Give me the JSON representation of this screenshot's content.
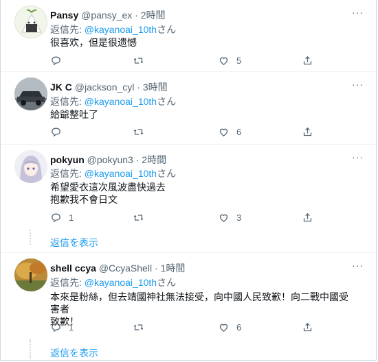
{
  "replies": [
    {
      "name": "Pansy",
      "handle": "@pansy_ex",
      "time": "2時間",
      "reply_prefix": "返信先:",
      "reply_to": "@kayanoai_10th",
      "reply_suffix": "さん",
      "lines": [
        "很喜欢，但是很遗憾"
      ],
      "reply_count": "",
      "retweet_count": "",
      "like_count": "5",
      "avatar": "onigiri-avatar"
    },
    {
      "name": "JK C",
      "handle": "@jackson_cyl",
      "time": "3時間",
      "reply_prefix": "返信先:",
      "reply_to": "@kayanoai_10th",
      "reply_suffix": "さん",
      "lines": [
        "給爺整吐了"
      ],
      "reply_count": "",
      "retweet_count": "",
      "like_count": "6",
      "avatar": "car-avatar"
    },
    {
      "name": "pokyun",
      "handle": "@pokyun3",
      "time": "2時間",
      "reply_prefix": "返信先:",
      "reply_to": "@kayanoai_10th",
      "reply_suffix": "さん",
      "lines": [
        "希望愛衣這次風波盡快過去",
        "抱歉我不會日文"
      ],
      "reply_count": "1",
      "retweet_count": "",
      "like_count": "3",
      "avatar": "anime-girl-avatar",
      "show_replies": "返信を表示"
    },
    {
      "name": "shell ccya",
      "handle": "@CcyaShell",
      "time": "1時間",
      "reply_prefix": "返信先:",
      "reply_to": "@kayanoai_10th",
      "reply_suffix": "さん",
      "lines": [
        "本來是粉絲，但去靖國神社無法接受，向中國人民致歉！向二戰中國受害者",
        "致歉！"
      ],
      "reply_count": "1",
      "retweet_count": "",
      "like_count": "6",
      "avatar": "autumn-tree-avatar",
      "show_replies": "返信を表示"
    }
  ],
  "more_glyph": "···",
  "separator_dot": "·",
  "colors": {
    "link": "#1d9bf0",
    "muted": "#536471",
    "text": "#0f1419",
    "divider": "#eff3f4"
  },
  "icons": [
    "reply-icon",
    "retweet-icon",
    "like-icon",
    "share-icon",
    "more-icon"
  ]
}
